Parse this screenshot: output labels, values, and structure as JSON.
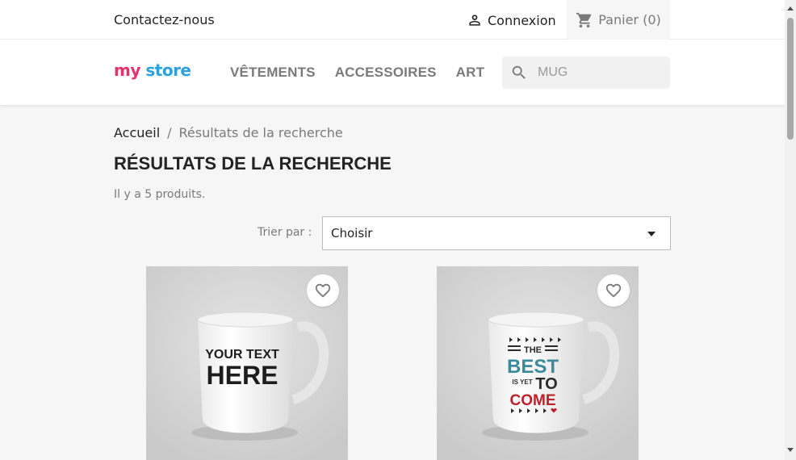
{
  "topbar": {
    "contact_label": "Contactez-nous",
    "login_label": "Connexion",
    "cart_label": "Panier (0)",
    "login_icon": "person-icon",
    "cart_icon": "cart-icon"
  },
  "header": {
    "logo": {
      "word1": "my",
      "word2": "store"
    },
    "nav": [
      "VÊTEMENTS",
      "ACCESSOIRES",
      "ART"
    ],
    "search": {
      "value": "",
      "placeholder": "MUG",
      "icon": "search-icon"
    }
  },
  "breadcrumb": {
    "home": "Accueil",
    "separator": "/",
    "current": "Résultats de la recherche"
  },
  "main": {
    "title": "RÉSULTATS DE LA RECHERCHE",
    "product_count": "Il y a 5 produits.",
    "sort_label": "Trier par :",
    "sort_value": "Choisir"
  },
  "products": [
    {
      "mug_text": [
        "YOUR TEXT",
        "HERE"
      ],
      "favorite_icon": "heart-icon"
    },
    {
      "mug_text": [
        "THE",
        "BEST",
        "IS YET",
        "TO",
        "COME"
      ],
      "favorite_icon": "heart-icon"
    }
  ],
  "colors": {
    "accent_teal": "#3d8a9a",
    "accent_red": "#c0202a",
    "text_primary": "#232323",
    "text_muted": "#7a7a7a"
  }
}
